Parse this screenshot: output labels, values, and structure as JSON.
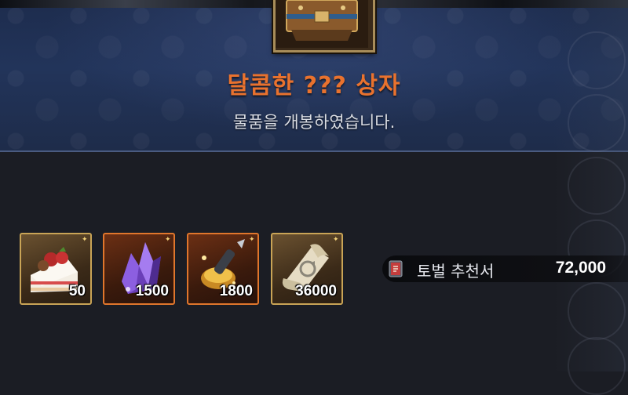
{
  "header": {
    "title": "달콤한 ??? 상자",
    "subtitle": "물품을 개봉하였습니다."
  },
  "items": [
    {
      "icon": "strawberry-cake-icon",
      "quantity": "50",
      "frame": "gold"
    },
    {
      "icon": "purple-crystal-icon",
      "quantity": "1500",
      "frame": "orange"
    },
    {
      "icon": "golden-pen-icon",
      "quantity": "1800",
      "frame": "orange"
    },
    {
      "icon": "scroll-icon",
      "quantity": "36000",
      "frame": "gold"
    }
  ],
  "reward": {
    "icon": "book-icon",
    "name": "토벌 추천서",
    "value": "72,000"
  },
  "colors": {
    "title": "#e9722e",
    "gold_frame": "#c9a456",
    "orange_frame": "#e0762c"
  }
}
